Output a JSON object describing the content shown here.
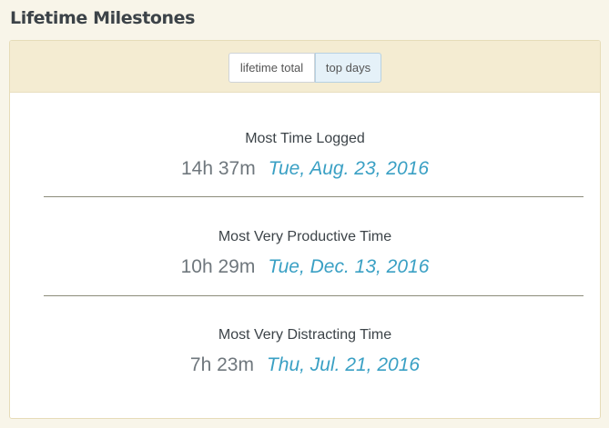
{
  "title": "Lifetime Milestones",
  "toggle": {
    "lifetime_total": "lifetime total",
    "top_days": "top days",
    "active": "top days"
  },
  "milestones": [
    {
      "label": "Most Time Logged",
      "duration": "14h 37m",
      "date": "Tue, Aug. 23, 2016"
    },
    {
      "label": "Most Very Productive Time",
      "duration": "10h 29m",
      "date": "Tue, Dec. 13, 2016"
    },
    {
      "label": "Most Very Distracting Time",
      "duration": "7h 23m",
      "date": "Thu, Jul. 21, 2016"
    }
  ],
  "colors": {
    "background": "#f8f5e9",
    "panel_header": "#f4ecd2",
    "date_link": "#3aa0c4",
    "duration_text": "#6f777d",
    "title_text": "#3c4348",
    "active_toggle": "#e5f1f8"
  }
}
